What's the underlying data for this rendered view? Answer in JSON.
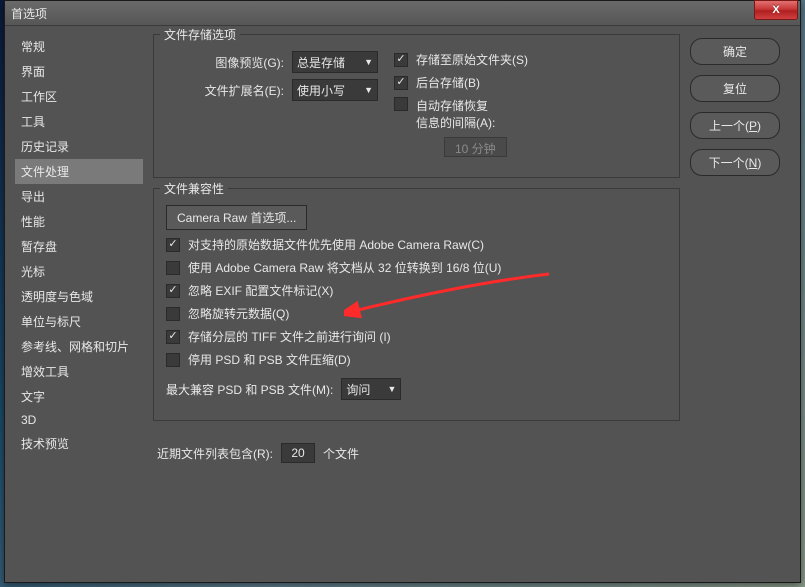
{
  "title": "首选项",
  "sidebar": {
    "items": [
      {
        "label": "常规"
      },
      {
        "label": "界面"
      },
      {
        "label": "工作区"
      },
      {
        "label": "工具"
      },
      {
        "label": "历史记录"
      },
      {
        "label": "文件处理"
      },
      {
        "label": "导出"
      },
      {
        "label": "性能"
      },
      {
        "label": "暂存盘"
      },
      {
        "label": "光标"
      },
      {
        "label": "透明度与色域"
      },
      {
        "label": "单位与标尺"
      },
      {
        "label": "参考线、网格和切片"
      },
      {
        "label": "增效工具"
      },
      {
        "label": "文字"
      },
      {
        "label": "3D"
      },
      {
        "label": "技术预览"
      }
    ],
    "selected_index": 5
  },
  "file_saving": {
    "legend": "文件存储选项",
    "image_preview_label": "图像预览(G):",
    "image_preview_value": "总是存储",
    "ext_case_label": "文件扩展名(E):",
    "ext_case_value": "使用小写",
    "save_original_label": "存储至原始文件夹(S)",
    "save_background_label": "后台存储(B)",
    "auto_save_label": "自动存储恢复",
    "auto_save_sub": "信息的间隔(A):",
    "auto_save_value": "10 分钟"
  },
  "compat": {
    "legend": "文件兼容性",
    "camera_raw_btn": "Camera Raw 首选项...",
    "cb_prefer_acr": "对支持的原始数据文件优先使用 Adobe Camera Raw(C)",
    "cb_convert_32": "使用 Adobe Camera Raw 将文档从 32 位转换到 16/8 位(U)",
    "cb_ignore_exif": "忽略 EXIF 配置文件标记(X)",
    "cb_ignore_rot": "忽略旋转元数据(Q)",
    "cb_ask_tiff": "存储分层的 TIFF 文件之前进行询问 (I)",
    "cb_disable_psd": "停用 PSD 和 PSB 文件压缩(D)",
    "max_compat_label": "最大兼容 PSD 和 PSB 文件(M):",
    "max_compat_value": "询问"
  },
  "recent": {
    "label": "近期文件列表包含(R):",
    "value": "20",
    "suffix": "个文件"
  },
  "buttons": {
    "ok": "确定",
    "reset": "复位",
    "prev": "上一个(P)",
    "next": "下一个(N)"
  }
}
